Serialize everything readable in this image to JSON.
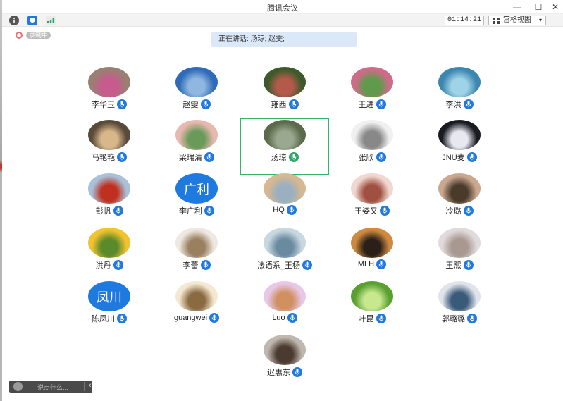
{
  "window": {
    "title": "腾讯会议",
    "minimize": "—",
    "maximize": "☐",
    "close": "✕"
  },
  "toolbar": {
    "info_icon": "info-icon",
    "shield_icon": "shield-icon",
    "signal_icon": "signal-icon",
    "timer": "01:14:21",
    "view_label": "宫格视图",
    "view_caret": "▾"
  },
  "recording": {
    "label": "录制中"
  },
  "speaking": {
    "text": "正在讲话: 汤琼; 赵雯;"
  },
  "participants": [
    {
      "name": "李华玉",
      "avatar": "photo"
    },
    {
      "name": "赵雯",
      "avatar": "photo"
    },
    {
      "name": "雍西",
      "avatar": "photo"
    },
    {
      "name": "王进",
      "avatar": "photo"
    },
    {
      "name": "李洪",
      "avatar": "photo"
    },
    {
      "name": "马艳艳",
      "avatar": "photo"
    },
    {
      "name": "梁瑞清",
      "avatar": "photo"
    },
    {
      "name": "汤琼",
      "avatar": "photo",
      "active": true
    },
    {
      "name": "张欣",
      "avatar": "photo"
    },
    {
      "name": "JNU麦",
      "avatar": "photo"
    },
    {
      "name": "彭帆",
      "avatar": "photo"
    },
    {
      "name": "李广利",
      "avatar": "text",
      "avatar_text": "广利"
    },
    {
      "name": "HQ",
      "avatar": "photo"
    },
    {
      "name": "王姿又",
      "avatar": "photo"
    },
    {
      "name": "冷璐",
      "avatar": "photo"
    },
    {
      "name": "洪丹",
      "avatar": "photo"
    },
    {
      "name": "李蕾",
      "avatar": "photo"
    },
    {
      "name": "法语系_王杨",
      "avatar": "photo"
    },
    {
      "name": "MLH",
      "avatar": "photo"
    },
    {
      "name": "王熙",
      "avatar": "photo"
    },
    {
      "name": "陈凤川",
      "avatar": "text",
      "avatar_text": "凤川"
    },
    {
      "name": "guangwei",
      "avatar": "photo"
    },
    {
      "name": "Luo",
      "avatar": "photo"
    },
    {
      "name": "叶昆",
      "avatar": "photo"
    },
    {
      "name": "郭璐璐",
      "avatar": "photo"
    },
    {
      "name": "迟惠东",
      "avatar": "photo"
    }
  ],
  "chat": {
    "placeholder": "说点什么...",
    "collapse": "‹"
  },
  "colors": {
    "accent": "#1f7ae0",
    "active_border": "#36b56a",
    "speaking_bg": "#dbe8f8"
  }
}
